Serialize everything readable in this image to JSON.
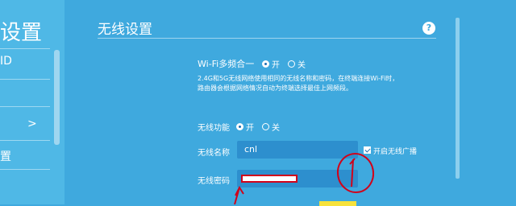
{
  "sidebar": {
    "title_fragment": "设置",
    "item1_fragment": "ID",
    "item2_fragment": "置",
    "chevron": ">"
  },
  "main": {
    "title": "无线设置",
    "help": "?",
    "multiband": {
      "label": "Wi-Fi多频合一",
      "on": "开",
      "off": "关",
      "selected": "开",
      "description": [
        "2.4G和5G无线网络使用相同的无线名称和密码，在终端连接Wi-Fi时，",
        "路由器会根据网络情况自动为终端选择最佳上网频段。"
      ]
    },
    "wireless": {
      "label": "无线功能",
      "on": "开",
      "off": "关",
      "selected": "开"
    },
    "ssid": {
      "label": "无线名称",
      "value": "cnl",
      "broadcast_label": "开启无线广播",
      "broadcast_checked": true
    },
    "password": {
      "label": "无线密码",
      "value": ""
    }
  },
  "colors": {
    "background": "#3fa9de",
    "input": "#2d8fce",
    "annotation": "#d0021b",
    "button": "#f7e23b"
  }
}
